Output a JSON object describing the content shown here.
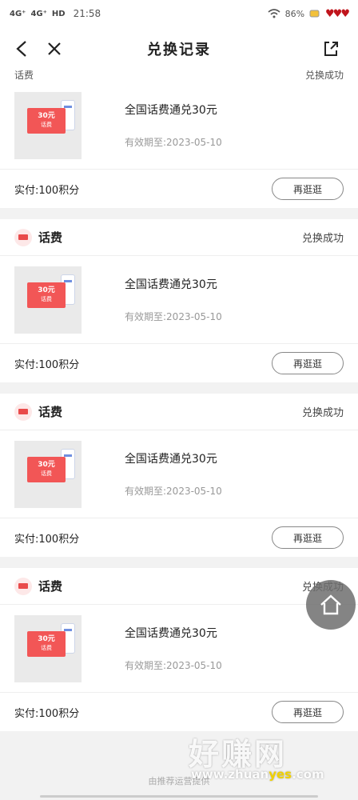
{
  "status_bar": {
    "signal_1": "4G⁺",
    "signal_2": "4G⁺",
    "hd": "HD",
    "time": "21:58",
    "battery": "86%"
  },
  "nav": {
    "title": "兑换记录"
  },
  "partial_card": {
    "merchant_name": "话费",
    "status": "兑换成功"
  },
  "cards": [
    {
      "merchant_name": "话费",
      "status": "兑换成功",
      "ticket_amount": "30元",
      "ticket_sub": "话费",
      "product_name": "全国话费通兑30元",
      "valid_date": "有效期至:2023-05-10",
      "paid": "实付:100积分",
      "button_label": "再逛逛"
    },
    {
      "merchant_name": "话费",
      "status": "兑换成功",
      "ticket_amount": "30元",
      "ticket_sub": "话费",
      "product_name": "全国话费通兑30元",
      "valid_date": "有效期至:2023-05-10",
      "paid": "实付:100积分",
      "button_label": "再逛逛"
    },
    {
      "merchant_name": "话费",
      "status": "兑换成功",
      "ticket_amount": "30元",
      "ticket_sub": "话费",
      "product_name": "全国话费通兑30元",
      "valid_date": "有效期至:2023-05-10",
      "paid": "实付:100积分",
      "button_label": "再逛逛"
    },
    {
      "merchant_name": "话费",
      "status": "兑换成功",
      "ticket_amount": "30元",
      "ticket_sub": "话费",
      "product_name": "全国话费通兑30元",
      "valid_date": "有效期至:2023-05-10",
      "paid": "实付:100积分",
      "button_label": "再逛逛"
    }
  ],
  "watermark": {
    "brand": "好赚网",
    "url_prefix": "www.zhuan",
    "url_highlight": "yes",
    "url_suffix": ".com"
  },
  "bottom_hint": "由推荐运营提供",
  "colors": {
    "accent_red": "#f25656",
    "text_main": "#222222",
    "text_muted": "#999999",
    "page_bg": "#f2f2f2",
    "watermark_yellow": "#f0d100"
  },
  "icons": [
    "back-arrow-icon",
    "close-icon",
    "share-icon",
    "home-icon",
    "wifi-icon",
    "battery-icon"
  ]
}
